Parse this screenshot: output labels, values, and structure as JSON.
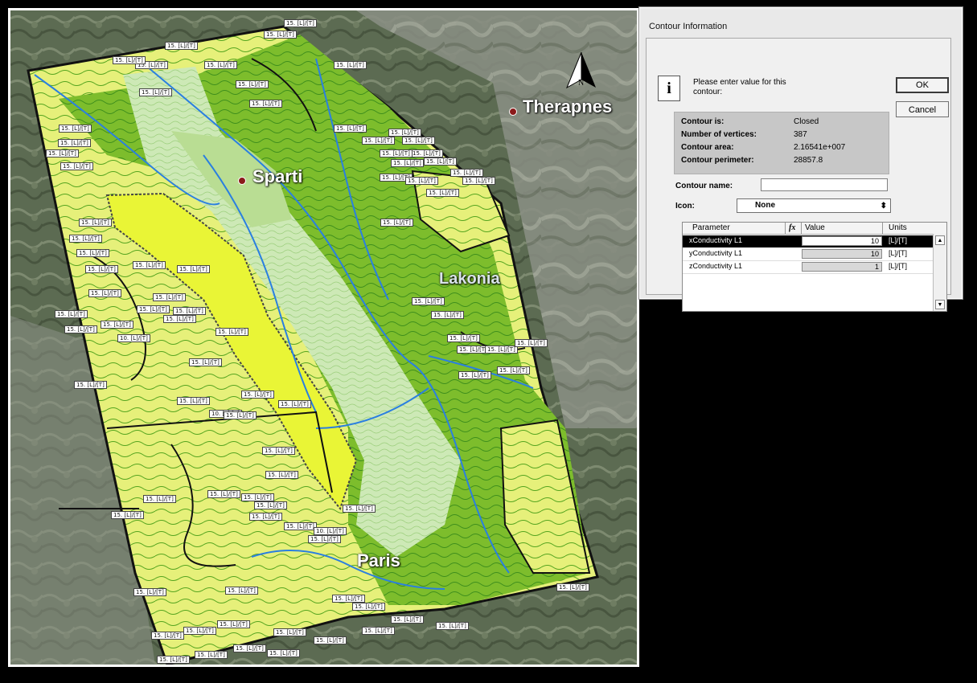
{
  "map": {
    "places": [
      {
        "name": "Sparti",
        "color": "#8b1a1a"
      },
      {
        "name": "Therapnes",
        "color": "#8b1a1a"
      },
      {
        "name": "Lakonia"
      },
      {
        "name": "Paris"
      }
    ],
    "north_letter": "N",
    "contour_tags": [
      "15. [L]/[T]",
      "10. [L]/[T]"
    ],
    "colors": {
      "bright_yellow": "#e8f23a",
      "light_yellow": "#f2f7a8",
      "light_green": "#cfe9b0",
      "mid_green": "#7fbf2a",
      "dark_green": "#5b9b1f",
      "river": "#2a7fe0",
      "contour_line": "#1a1a1a"
    }
  },
  "dialog": {
    "title": "Contour Information",
    "prompt": "Please enter value for this contour:",
    "ok_label": "OK",
    "cancel_label": "Cancel",
    "stats": [
      {
        "label": "Contour is:",
        "value": "Closed"
      },
      {
        "label": "Number of vertices:",
        "value": "387"
      },
      {
        "label": "Contour area:",
        "value": "2.16541e+007"
      },
      {
        "label": "Contour perimeter:",
        "value": "28857.8"
      }
    ],
    "name_label": "Contour name:",
    "name_value": "",
    "icon_label": "Icon:",
    "icon_value": "None",
    "table": {
      "headers": [
        "Parameter",
        "fx",
        "Value",
        "Units"
      ],
      "rows": [
        {
          "parameter": "xConductivity L1",
          "value": "10",
          "units": "[L]/[T]"
        },
        {
          "parameter": "yConductivity L1",
          "value": "10",
          "units": "[L]/[T]"
        },
        {
          "parameter": "zConductivity L1",
          "value": "1",
          "units": "[L]/[T]"
        }
      ]
    }
  }
}
